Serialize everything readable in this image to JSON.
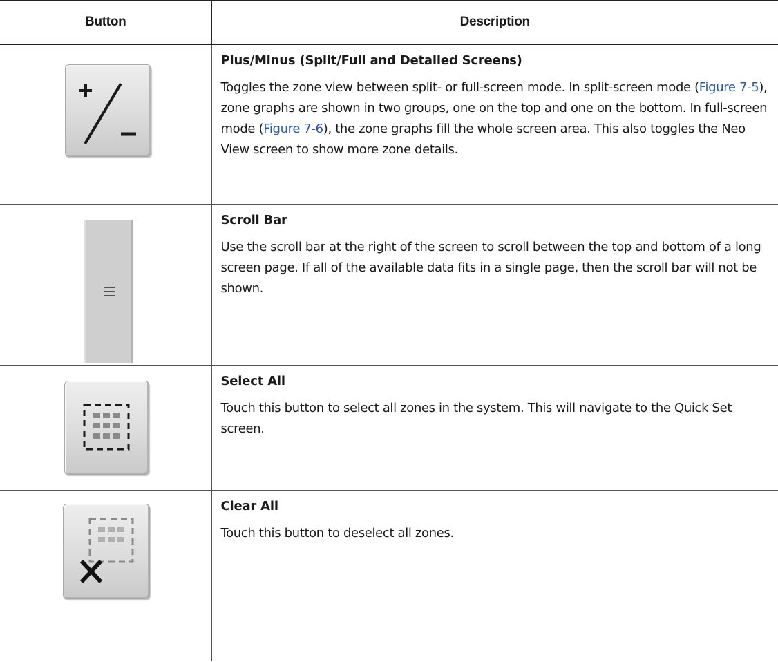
{
  "table": {
    "headers": {
      "button": "Button",
      "description": "Description"
    },
    "rows": [
      {
        "icon": "plus-minus-icon",
        "title": "Plus/Minus (Split/Full and Detailed Screens)",
        "text_1": "Toggles the zone view between split- or full-screen mode. In split-screen mode (",
        "link_1": "Figure 7-5",
        "text_2": "), zone graphs are shown in two groups, one on the top and one on the bottom. In full-screen mode (",
        "link_2": "Figure 7-6",
        "text_3": "), the zone graphs fill the whole screen area. This also toggles the Neo View screen to show more zone details."
      },
      {
        "icon": "scroll-bar-icon",
        "title": "Scroll Bar",
        "text": "Use the scroll bar at the right of the screen to scroll between the top and bottom of a long screen page. If all of the available data fits in a single page, then the scroll bar will not be shown."
      },
      {
        "icon": "select-all-icon",
        "title": "Select All",
        "text": "Touch this button to select all zones in the system. This will navigate to the Quick Set screen."
      },
      {
        "icon": "clear-all-icon",
        "title": "Clear All",
        "text": "Touch this button to deselect all zones."
      }
    ]
  },
  "colors": {
    "link": "#2a57a8",
    "rule": "#222222",
    "button_face": "#dcdcdc"
  }
}
